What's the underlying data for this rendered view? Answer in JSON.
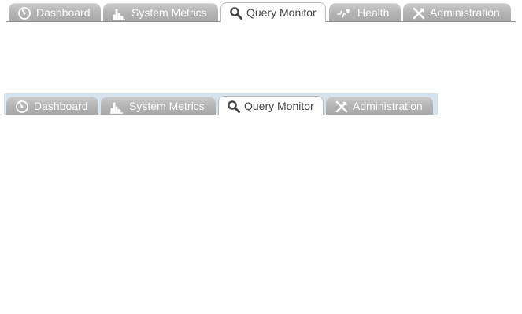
{
  "colors": {
    "tab_inactive": "#b4b4b4",
    "tab_active": "#ffffff",
    "tab_text_inactive": "#ffffff",
    "tab_text_active": "#444444",
    "bar2_background": "#d5e3ef"
  },
  "tabbar_primary": {
    "tabs": [
      {
        "label": "Dashboard",
        "icon": "gauge-icon",
        "active": false
      },
      {
        "label": "System Metrics",
        "icon": "chart-icon",
        "active": false
      },
      {
        "label": "Query Monitor",
        "icon": "search-icon",
        "active": true
      },
      {
        "label": "Health",
        "icon": "heartbeat-icon",
        "active": false
      },
      {
        "label": "Administration",
        "icon": "tools-icon",
        "active": false
      }
    ]
  },
  "tabbar_secondary": {
    "tabs": [
      {
        "label": "Dashboard",
        "icon": "gauge-icon",
        "active": false
      },
      {
        "label": "System Metrics",
        "icon": "chart-icon",
        "active": false
      },
      {
        "label": "Query Monitor",
        "icon": "search-icon",
        "active": true
      },
      {
        "label": "Administration",
        "icon": "tools-icon",
        "active": false
      }
    ]
  }
}
